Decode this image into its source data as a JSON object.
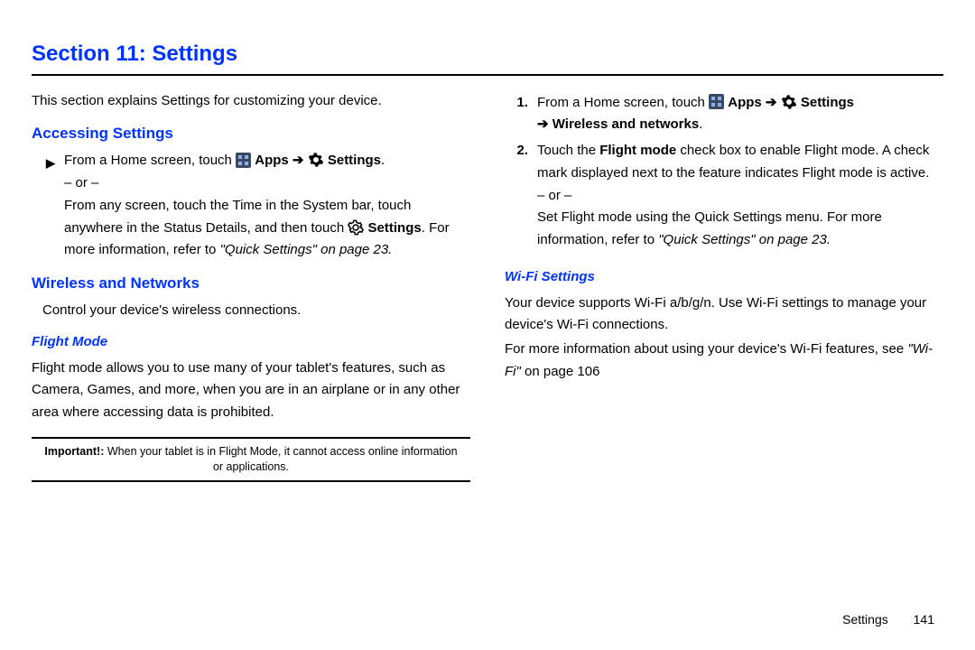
{
  "section_title": "Section 11: Settings",
  "intro_text": "This section explains Settings for customizing your device.",
  "heading_accessing": "Accessing Settings",
  "step_accessing_lead": "From a Home screen, touch ",
  "label_apps": " Apps ",
  "label_settings": " Settings",
  "period": ".",
  "or_text": "– or –",
  "accessing_alt1": "From any screen, touch the Time in the System bar, touch anywhere in the Status Details, and then touch ",
  "accessing_alt2": " Settings",
  "accessing_alt3": ". For more information, refer to ",
  "quick_settings_ref": "\"Quick Settings\"",
  "on_page23": "  on page 23.",
  "heading_wireless": "Wireless and Networks",
  "wireless_intro": "Control your device's wireless connections.",
  "heading_flight": "Flight Mode",
  "flight_text": "Flight mode allows you to use many of your tablet's features, such as Camera, Games, and more, when you are in an airplane or in any other area where accessing data is prohibited.",
  "important_label": "Important!:",
  "important_text": " When your tablet is in Flight Mode, it cannot access online information or applications.",
  "col2_step1_lead": "From a Home screen, touch ",
  "col2_step1_tail": "Wireless and networks",
  "arrow_lead": "➔ ",
  "col2_step2_a": "Touch the ",
  "col2_step2_flight": "Flight mode",
  "col2_step2_b": " check box to enable Flight mode. A check mark displayed next to the feature indicates Flight mode is active.",
  "col2_alt": "Set Flight mode using the Quick Settings menu. For more information, refer to ",
  "heading_wifi": "Wi-Fi Settings",
  "wifi_text1": "Your device supports Wi-Fi a/b/g/n. Use Wi-Fi settings to manage your device's Wi-Fi connections.",
  "wifi_text2a": "For more information about using your device's Wi-Fi features, see ",
  "wifi_ref": "\"Wi-Fi\" ",
  "wifi_text2b": "on page 106",
  "footer_label": "Settings",
  "footer_page": "141",
  "marker_1": "1.",
  "marker_2": "2."
}
